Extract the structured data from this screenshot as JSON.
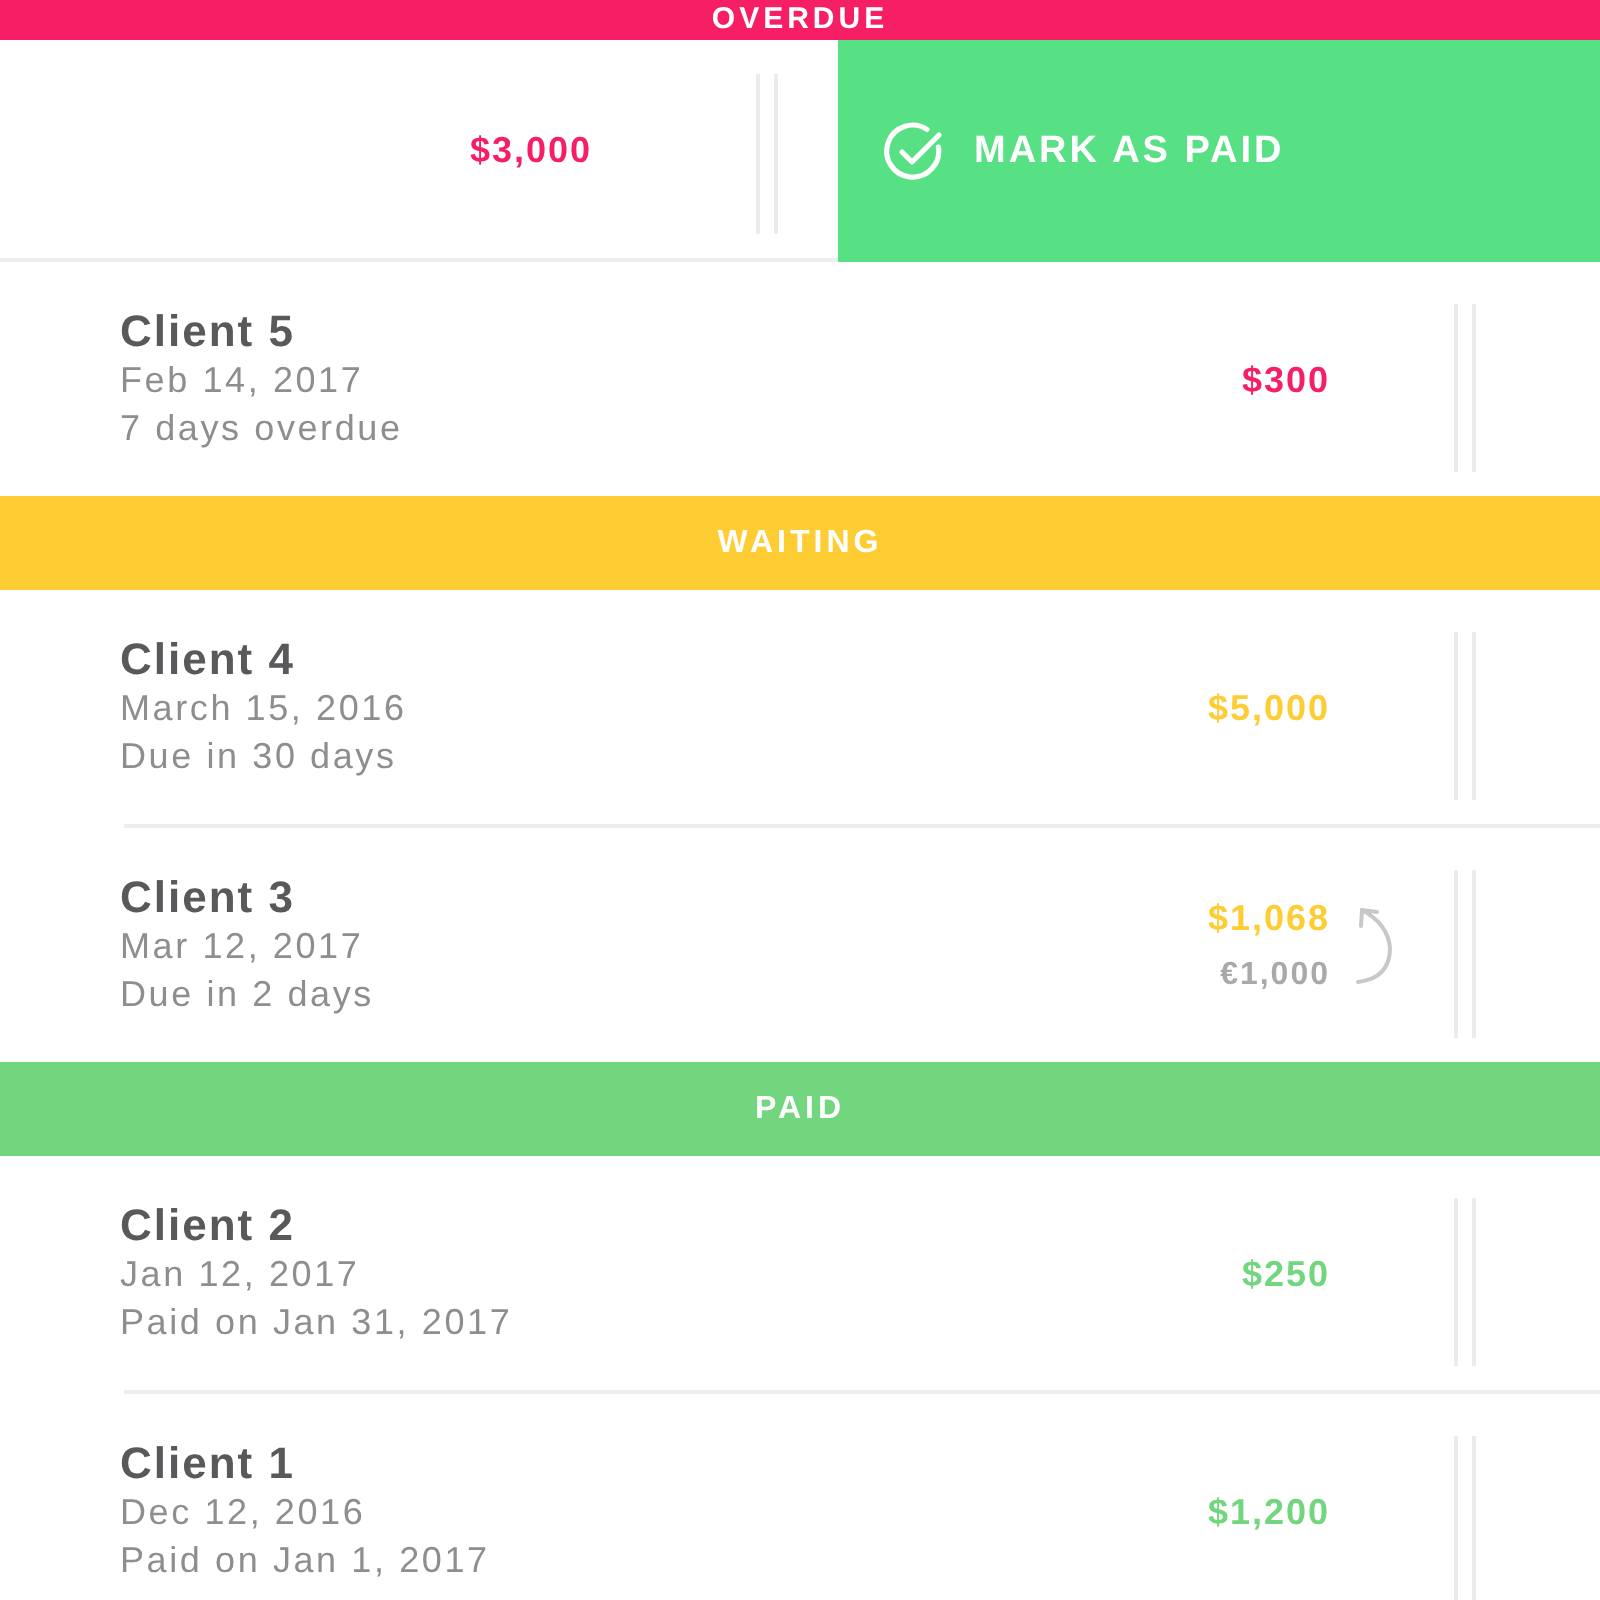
{
  "sections": [
    {
      "title": "OVERDUE",
      "color": "#f61f66",
      "rows": [
        {
          "kind": "swiped",
          "amount": "$3,000",
          "action": "MARK AS PAID"
        },
        {
          "kind": "invoice",
          "name": "Client 5",
          "date": "Feb 14, 2017",
          "status": "7 days overdue",
          "amount": "$300"
        }
      ]
    },
    {
      "title": "WAITING",
      "color": "#fecd34",
      "rows": [
        {
          "kind": "invoice",
          "name": "Client 4",
          "date": "March 15, 2016",
          "status": "Due in 30 days",
          "amount": "$5,000"
        },
        {
          "kind": "invoice",
          "name": "Client 3",
          "date": "Mar 12, 2017",
          "status": "Due in 2 days",
          "amount": "$1,068",
          "converted_from": "€1,000"
        }
      ]
    },
    {
      "title": "PAID",
      "color": "#72d67f",
      "rows": [
        {
          "kind": "invoice",
          "name": "Client 2",
          "date": "Jan 12, 2017",
          "status": "Paid on Jan 31, 2017",
          "amount": "$250"
        },
        {
          "kind": "invoice",
          "name": "Client 1",
          "date": "Dec 12, 2016",
          "status": "Paid on Jan 1, 2017",
          "amount": "$1,200"
        }
      ]
    }
  ]
}
